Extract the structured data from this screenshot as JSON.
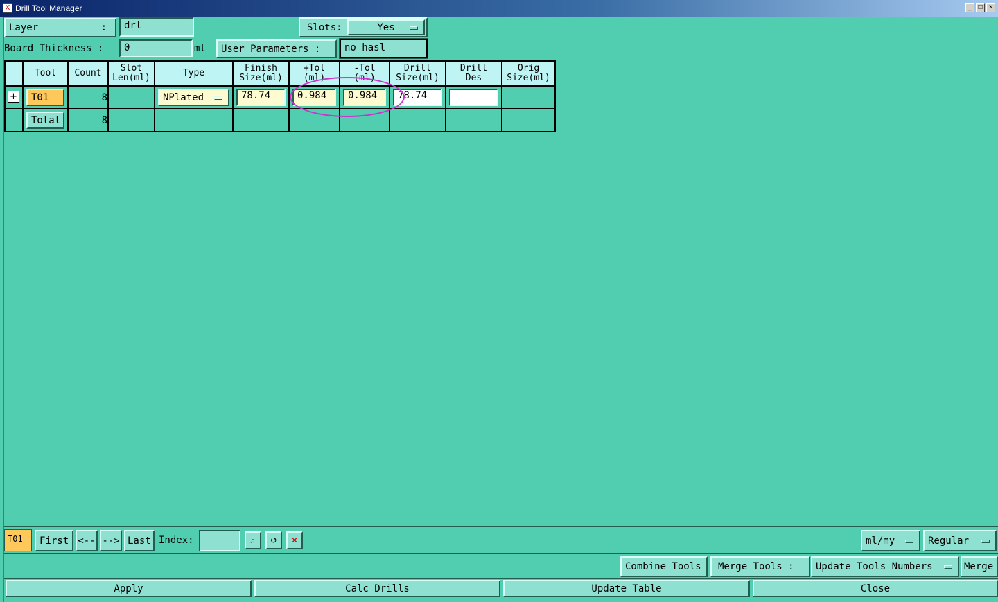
{
  "window": {
    "title": "Drill Tool Manager",
    "icon": "x-app-icon"
  },
  "header": {
    "layer_label": "Layer",
    "layer_colon": ":",
    "layer_value": "drl",
    "slots_label": "Slots:",
    "slots_value": "Yes",
    "board_thickness_label": "Board Thickness :",
    "board_thickness_value": "0",
    "board_thickness_unit": "ml",
    "user_params_label": "User Parameters :",
    "user_params_value": "no_hasl"
  },
  "table": {
    "columns": [
      {
        "line1": "",
        "line2": ""
      },
      {
        "line1": "Tool",
        "line2": ""
      },
      {
        "line1": "Count",
        "line2": ""
      },
      {
        "line1": "Slot",
        "line2": "Len(ml)"
      },
      {
        "line1": "Type",
        "line2": ""
      },
      {
        "line1": "Finish",
        "line2": "Size(ml)"
      },
      {
        "line1": "+Tol",
        "line2": "(ml)"
      },
      {
        "line1": "-Tol",
        "line2": "(ml)"
      },
      {
        "line1": "Drill",
        "line2": "Size(ml)"
      },
      {
        "line1": "Drill",
        "line2": "Des"
      },
      {
        "line1": "Orig",
        "line2": "Size(ml)"
      }
    ],
    "row": {
      "tool": "T01",
      "count": "8",
      "type": "NPlated",
      "finish_size": "78.74",
      "plus_tol": "0.984",
      "minus_tol": "0.984",
      "drill_size": "78.74",
      "drill_des": ""
    },
    "total": {
      "label": "Total",
      "count": "8"
    }
  },
  "nav": {
    "current": "T01",
    "first": "First",
    "prev": "<--",
    "next": "-->",
    "last": "Last",
    "index_label": "Index:",
    "index_value": "",
    "units": "ml/my",
    "mode": "Regular"
  },
  "actions": {
    "combine_tools": "Combine Tools",
    "merge_tools_label": "Merge Tools :",
    "merge_option": "Update Tools Numbers",
    "merge": "Merge"
  },
  "footer": {
    "apply": "Apply",
    "calc_drills": "Calc Drills",
    "update_table": "Update Table",
    "close": "Close"
  }
}
